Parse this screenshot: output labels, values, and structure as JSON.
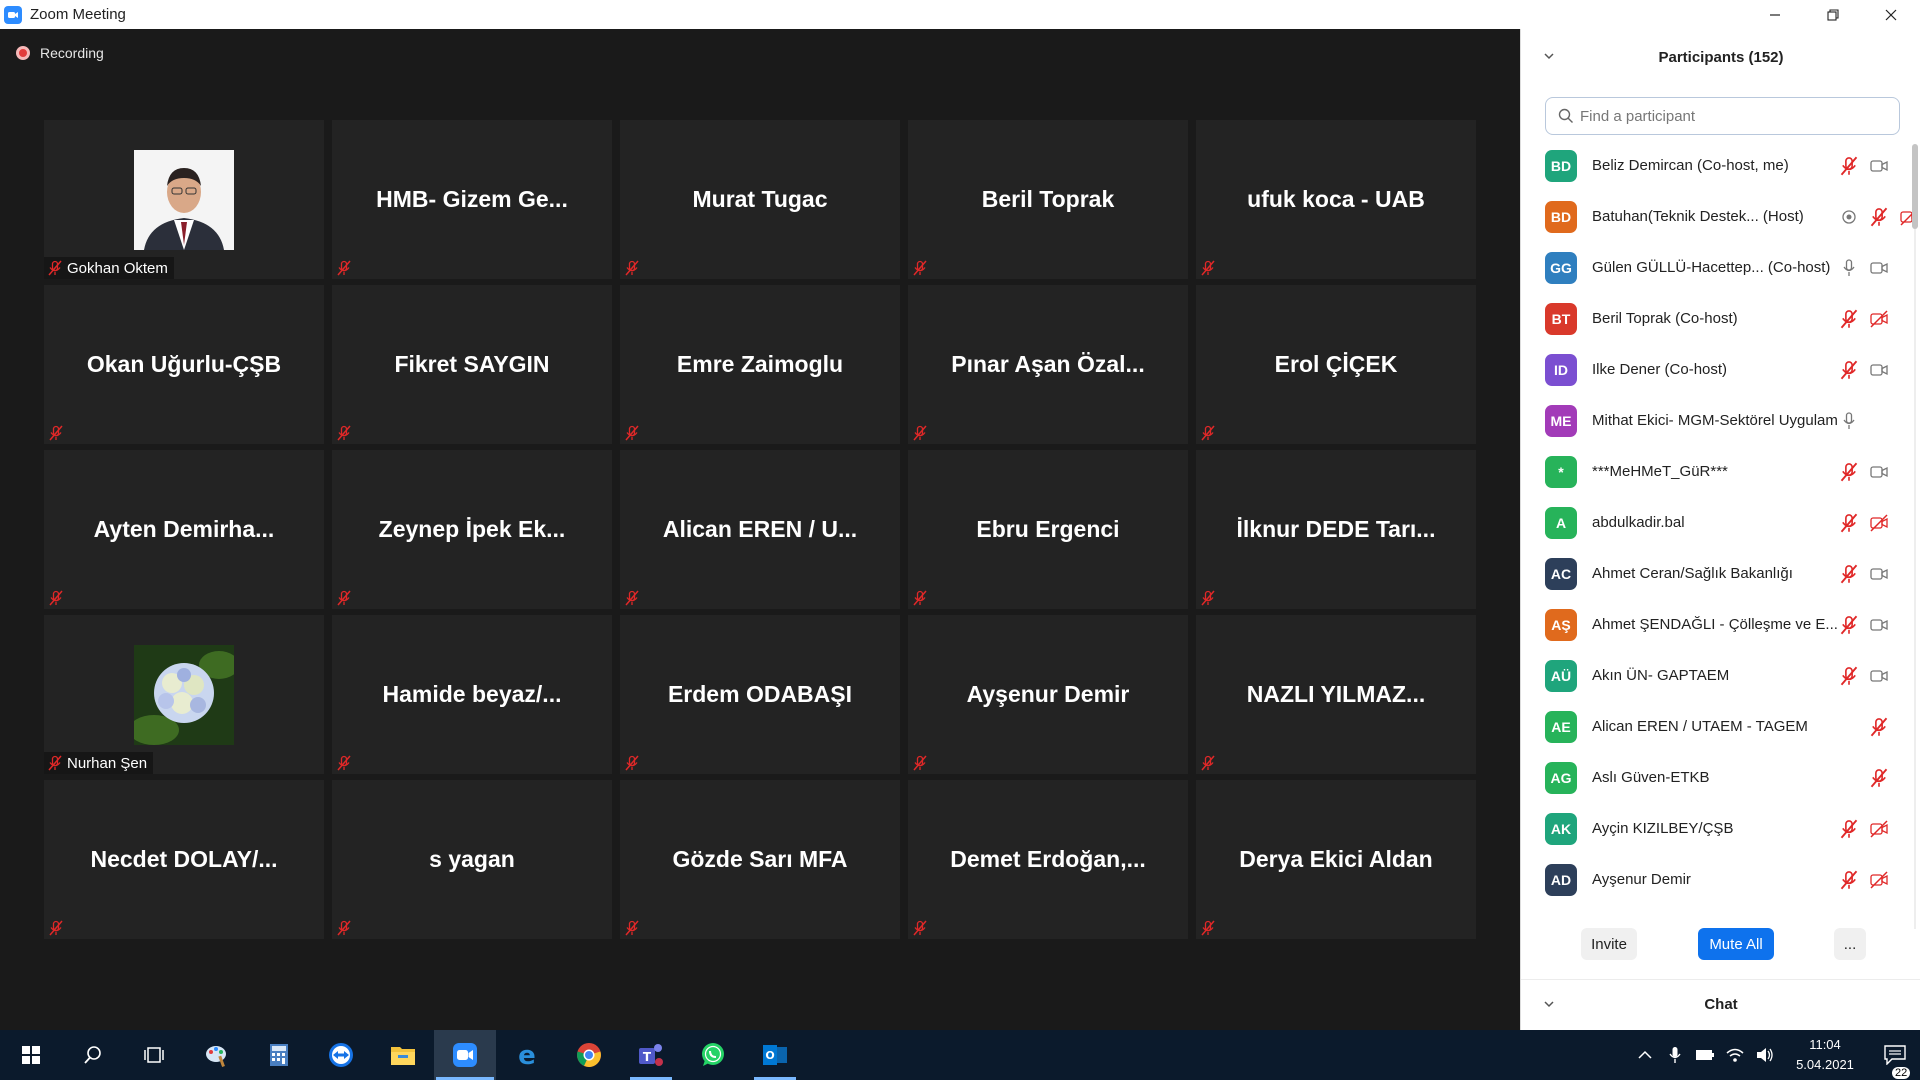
{
  "window": {
    "title": "Zoom Meeting"
  },
  "recording": {
    "label": "Recording"
  },
  "tiles": [
    {
      "name": "Gokhan Oktem",
      "type": "photo",
      "photo": "man-portrait"
    },
    {
      "name": "HMB-  Gizem Ge..."
    },
    {
      "name": "Murat Tugac"
    },
    {
      "name": "Beril Toprak"
    },
    {
      "name": "ufuk koca - UAB"
    },
    {
      "name": "Okan Uğurlu-ÇŞB"
    },
    {
      "name": "Fikret SAYGIN"
    },
    {
      "name": "Emre Zaimoglu"
    },
    {
      "name": "Pınar  Aşan  Özal..."
    },
    {
      "name": "Erol ÇİÇEK"
    },
    {
      "name": "Ayten  Demirha..."
    },
    {
      "name": "Zeynep  İpek  Ek..."
    },
    {
      "name": "Alican  EREN  /  U..."
    },
    {
      "name": "Ebru Ergenci"
    },
    {
      "name": "İlknur  DEDE  Tarı..."
    },
    {
      "name": "Nurhan Şen",
      "type": "photo",
      "photo": "hydrangea-flower"
    },
    {
      "name": "Hamide  beyaz/..."
    },
    {
      "name": "Erdem ODABAŞI"
    },
    {
      "name": "Ayşenur Demir"
    },
    {
      "name": "NAZLI  YILMAZ..."
    },
    {
      "name": "Necdet  DOLAY/..."
    },
    {
      "name": "s yagan"
    },
    {
      "name": "Gözde Sarı MFA"
    },
    {
      "name": "Demet  Erdoğan,..."
    },
    {
      "name": "Derya Ekici Aldan"
    }
  ],
  "participants_panel": {
    "title": "Participants (152)",
    "search_placeholder": "Find a participant",
    "participants": [
      {
        "initials": "BD",
        "name": "Beliz Demircan (Co-host, me)",
        "color": "#1fa57c",
        "mic": "muted",
        "video": "on"
      },
      {
        "initials": "BD",
        "name": "Batuhan(Teknik Destek...  (Host)",
        "color": "#e06a1d",
        "mic": "muted",
        "video": "off",
        "record": true
      },
      {
        "initials": "GG",
        "name": "Gülen GÜLLÜ-Hacettep...  (Co-host)",
        "color": "#2f7fbf",
        "mic": "on",
        "video": "on"
      },
      {
        "initials": "BT",
        "name": "Beril Toprak (Co-host)",
        "color": "#d9392b",
        "mic": "muted",
        "video": "off"
      },
      {
        "initials": "ID",
        "name": "Ilke Dener (Co-host)",
        "color": "#7b4fd1",
        "mic": "muted",
        "video": "on"
      },
      {
        "initials": "ME",
        "name": "Mithat Ekici- MGM-Sektörel Uygulam...",
        "color": "#a23bb8",
        "mic": "on",
        "video": "none"
      },
      {
        "initials": "*",
        "name": "***MeHMeT_GüR***",
        "color": "#27b35a",
        "mic": "muted",
        "video": "on"
      },
      {
        "initials": "A",
        "name": "abdulkadir.bal",
        "color": "#27b35a",
        "mic": "muted",
        "video": "off"
      },
      {
        "initials": "AC",
        "name": "Ahmet Ceran/Sağlık Bakanlığı",
        "color": "#2d3f5a",
        "mic": "muted",
        "video": "on"
      },
      {
        "initials": "AŞ",
        "name": "Ahmet ŞENDAĞLI - Çölleşme ve E...",
        "color": "#e06a1d",
        "mic": "muted",
        "video": "on"
      },
      {
        "initials": "AÜ",
        "name": "Akın ÜN- GAPTAEM",
        "color": "#1fa57c",
        "mic": "muted",
        "video": "on"
      },
      {
        "initials": "AE",
        "name": "Alican EREN / UTAEM - TAGEM",
        "color": "#27b35a",
        "mic": "none",
        "video": "muted-only"
      },
      {
        "initials": "AG",
        "name": "Aslı Güven-ETKB",
        "color": "#27b35a",
        "mic": "none",
        "video": "muted-only"
      },
      {
        "initials": "AK",
        "name": "Ayçin KIZILBEY/ÇŞB",
        "color": "#1fa57c",
        "mic": "muted",
        "video": "off"
      },
      {
        "initials": "AD",
        "name": "Ayşenur Demir",
        "color": "#2d3f5a",
        "mic": "muted",
        "video": "off"
      }
    ],
    "buttons": {
      "invite": "Invite",
      "mute_all": "Mute All",
      "more": "..."
    },
    "chat_title": "Chat"
  },
  "taskbar": {
    "time": "11:04",
    "date": "5.04.2021",
    "notifications": "22",
    "apps": [
      "start-icon",
      "search-icon",
      "task-view-icon",
      "paint-icon",
      "calculator-icon",
      "teamviewer-icon",
      "file-explorer-icon",
      "zoom-icon",
      "edge-icon",
      "chrome-icon",
      "teams-icon",
      "whatsapp-icon",
      "outlook-icon"
    ]
  }
}
